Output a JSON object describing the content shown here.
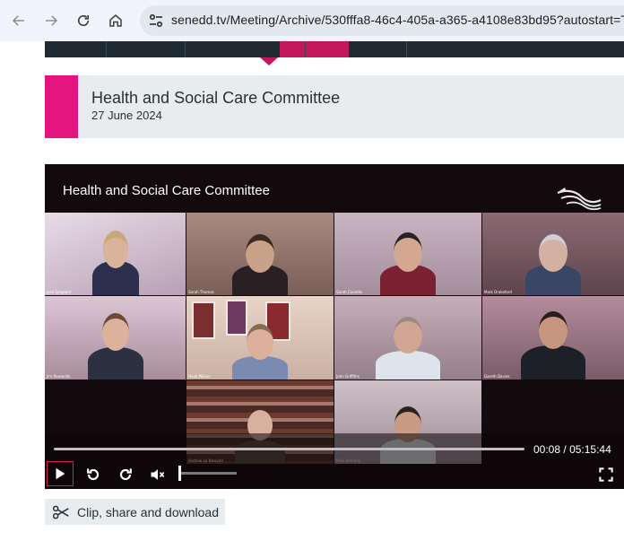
{
  "browser": {
    "url": "senedd.tv/Meeting/Archive/530fffa8-46c4-405a-a365-a4108e83bd95?autostart=T",
    "back_icon": "arrow-left-icon",
    "forward_icon": "arrow-right-icon",
    "reload_icon": "reload-icon",
    "home_icon": "home-icon",
    "site_info_icon": "tune-icon"
  },
  "meeting": {
    "title": "Health and Social Care Committee",
    "date": "27 June 2024",
    "accent_color": "#e5157f",
    "nav_active_color": "#c2185b"
  },
  "player": {
    "overlay_title": "Health and Social Care Committee",
    "current_time": "00:08",
    "separator": "/",
    "duration": "05:15:44",
    "progress_fraction": 0.0004,
    "muted": true,
    "volume_fraction": 0.0,
    "participants": [
      {
        "name": "Jack Sargeant"
      },
      {
        "name": "Sarah Thomas"
      },
      {
        "name": "Sarah Coombs"
      },
      {
        "name": "Mark Drakeford"
      },
      {
        "name": "Jim Rowlands"
      },
      {
        "name": "Heidi Wilson"
      },
      {
        "name": "John Griffiths"
      },
      {
        "name": "Gareth Davies"
      },
      {
        "name": "Andrew ap Newydd"
      },
      {
        "name": "Mike Anthony"
      }
    ]
  },
  "actions": {
    "clip_label": "Clip, share and download",
    "clip_icon": "scissors-icon"
  }
}
